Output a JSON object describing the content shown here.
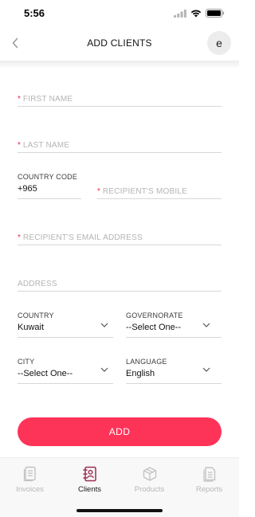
{
  "status": {
    "time": "5:56"
  },
  "header": {
    "title": "ADD CLIENTS",
    "avatar_letter": "e"
  },
  "form": {
    "first_name": {
      "placeholder": "FIRST NAME",
      "required_mark": "*"
    },
    "last_name": {
      "placeholder": "LAST NAME",
      "required_mark": "*"
    },
    "country_code": {
      "label": "COUNTRY CODE",
      "value": "+965"
    },
    "recipient_mobile": {
      "placeholder": "RECIPIENT'S MOBILE",
      "required_mark": "*"
    },
    "recipient_email": {
      "placeholder": "RECIPIENT'S EMAIL ADDRESS",
      "required_mark": "*"
    },
    "address": {
      "placeholder": "ADDRESS"
    },
    "country": {
      "label": "COUNTRY",
      "value": "Kuwait"
    },
    "governorate": {
      "label": "GOVERNORATE",
      "value": "--Select One--"
    },
    "city": {
      "label": "CITY",
      "value": "--Select One--"
    },
    "language": {
      "label": "LANGUAGE",
      "value": "English"
    }
  },
  "add_button": {
    "label": "ADD"
  },
  "tabbar": {
    "tabs": [
      {
        "label": "Invoices",
        "icon": "document-icon",
        "active": false
      },
      {
        "label": "Clients",
        "icon": "contact-book-icon",
        "active": true
      },
      {
        "label": "Products",
        "icon": "box-icon",
        "active": false
      },
      {
        "label": "Reports",
        "icon": "reports-icon",
        "active": false
      }
    ]
  },
  "colors": {
    "accent": "#fe3358",
    "required": "#f0284a",
    "active_icon": "#9b2d55",
    "inactive": "#b7b7b7"
  }
}
